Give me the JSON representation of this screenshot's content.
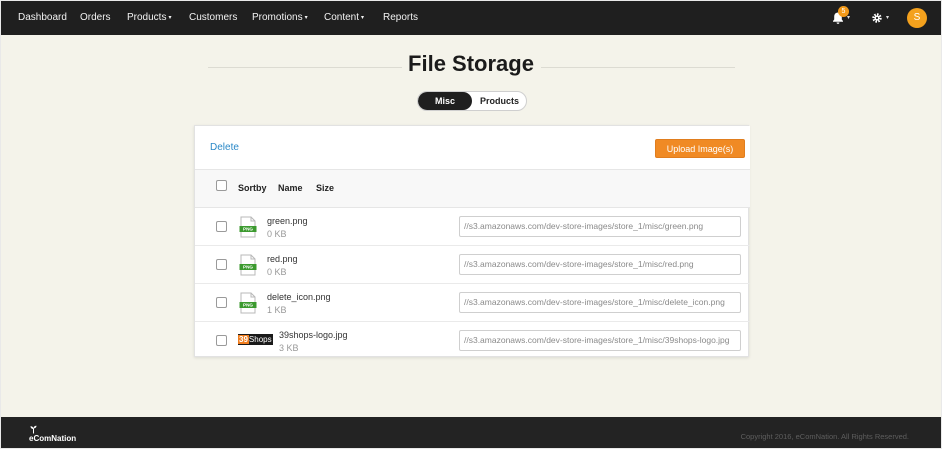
{
  "nav": {
    "items": [
      {
        "label": "Dashboard",
        "caret": ""
      },
      {
        "label": "Orders",
        "caret": ""
      },
      {
        "label": "Products",
        "caret": "▾"
      },
      {
        "label": "Customers",
        "caret": ""
      },
      {
        "label": "Promotions",
        "caret": "▾"
      },
      {
        "label": "Content",
        "caret": "▾"
      },
      {
        "label": "Reports",
        "caret": ""
      }
    ],
    "notification_count": "5",
    "avatar_initial": "S",
    "caret": "▾"
  },
  "page": {
    "title": "File Storage",
    "tabs": [
      "Misc",
      "Products"
    ],
    "active_tab": "Misc"
  },
  "toolbar": {
    "delete_label": "Delete",
    "upload_label": "Upload Image(s)"
  },
  "columns": [
    "Sortby",
    "Name",
    "Size"
  ],
  "files": [
    {
      "name": "green.png",
      "size": "0 KB",
      "icon": "png-file-icon",
      "url": "//s3.amazonaws.com/dev-store-images/store_1/misc/green.png"
    },
    {
      "name": "red.png",
      "size": "0 KB",
      "icon": "png-file-icon",
      "url": "//s3.amazonaws.com/dev-store-images/store_1/misc/red.png"
    },
    {
      "name": "delete_icon.png",
      "size": "1 KB",
      "icon": "png-file-icon",
      "url": "//s3.amazonaws.com/dev-store-images/store_1/misc/delete_icon.png"
    },
    {
      "name": "39shops-logo.jpg",
      "size": "3 KB",
      "icon": "39shops-logo-thumbnail",
      "url": "//s3.amazonaws.com/dev-store-images/store_1/misc/39shops-logo.jpg",
      "thumb_text": {
        "num": "39",
        "word": "Shops"
      }
    }
  ],
  "icon_label": "PNG",
  "footer": {
    "brand": "eComNation",
    "copyright": "Copyright 2016, eComNation. All Rights Reserved."
  },
  "colors": {
    "nav_bg": "#1f1f1f",
    "page_bg": "#f4f3ea",
    "accent_orange": "#f08a24",
    "link_blue": "#2a88c7",
    "footer_bg": "#232323"
  }
}
